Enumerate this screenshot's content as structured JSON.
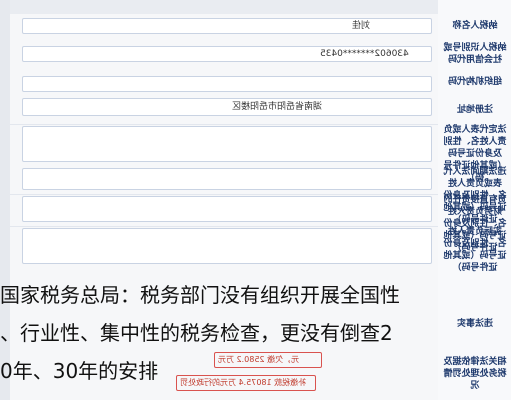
{
  "form": {
    "labels": [
      "纳税人名称",
      "纳税人识别号或社会信用代码",
      "组织机构代码",
      "注册地址",
      "法定代表人或负责人姓名、性别及身份证号码（或其他证件号码）",
      "违法期间法人代表或负责人姓名、性别及身份证号码（或其他证件号码）",
      "负有直接责任的财务负责人姓名、性别及身份证号码（或其他证件号码）",
      "实际负责人姓名、性别及身份证号码（或其他证件号码）",
      "违法事实",
      "相关法律依据及税务处理处罚情况"
    ],
    "values": {
      "name": "刘佳",
      "tax_id": "430602*******0435",
      "address": "湖南省岳阳市岳阳楼区"
    },
    "bottom_snippets": [
      "元，欠缴  2580.2 万元",
      "补缴税款  18075.4 万元的行政处罚"
    ]
  },
  "caption": {
    "line1": "国家税务总局：税务部门没有组织开展全国性",
    "line2": "、行业性、集中性的税务检查，更没有倒查2",
    "line3": "0年、30年的安排"
  }
}
